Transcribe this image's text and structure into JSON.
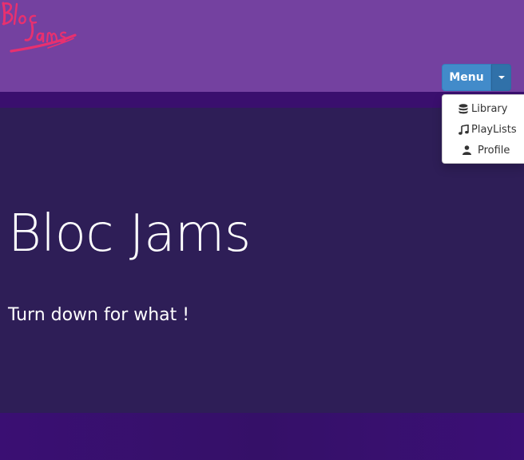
{
  "brand": {
    "logo_text": "Bloc Jams"
  },
  "header": {
    "menu_button_label": "Menu"
  },
  "dropdown": {
    "items": [
      {
        "label": "Library",
        "icon": "database-icon"
      },
      {
        "label": "PlayLists",
        "icon": "music-note-icon"
      },
      {
        "label": "Profile",
        "icon": "user-icon"
      }
    ]
  },
  "hero": {
    "title": "Bloc Jams",
    "subtitle": "Turn down for what !"
  },
  "colors": {
    "navbar": "#7441a0",
    "hero": "#2e1e57",
    "accent": "#428bca",
    "logo": "#e8306f"
  }
}
